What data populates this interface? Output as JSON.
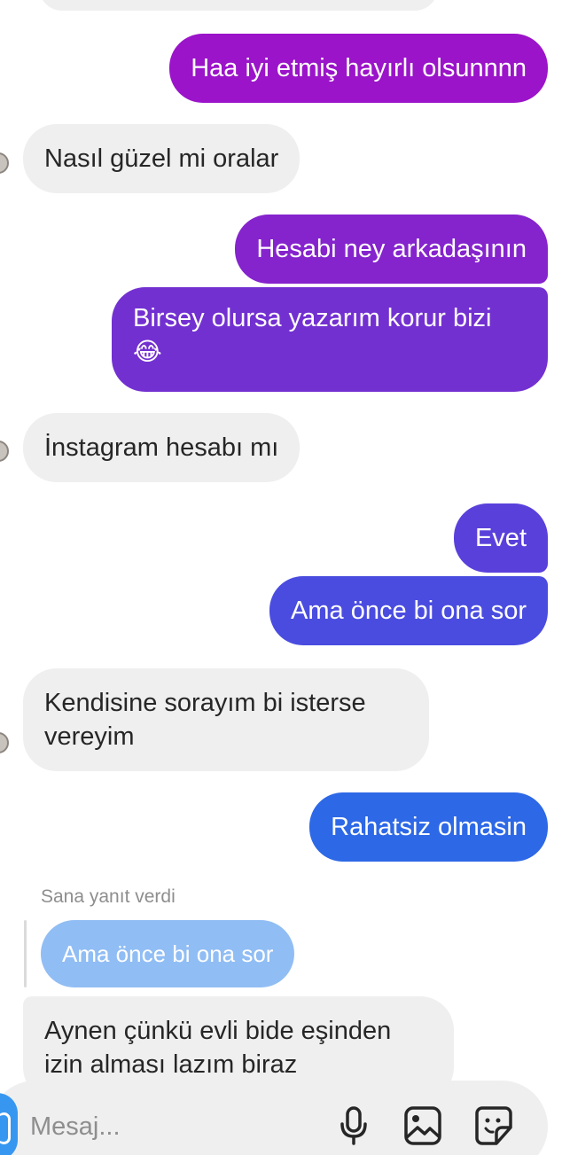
{
  "messages": [
    {
      "text": "Haa iyi etmiş hayırlı olsunnnn"
    },
    {
      "text": "Nasıl güzel mi oralar"
    },
    {
      "text": "Hesabi ney arkadaşının"
    },
    {
      "line1": "Birsey olursa yazarım korur bizi",
      "emoji": "😂"
    },
    {
      "text": "İnstagram hesabı mı"
    },
    {
      "text": "Evet"
    },
    {
      "text": "Ama önce bi ona sor"
    },
    {
      "line1": "Kendisine sorayım bi isterse",
      "line2": "vereyim"
    },
    {
      "text": "Rahatsiz olmasin"
    },
    {
      "line1": "Aynen çünkü evli bide eşinden",
      "line2": "izin alması lazım biraz"
    }
  ],
  "reply": {
    "caption": "Sana yanıt verdi",
    "quoted_text": "Ama önce bi ona sor"
  },
  "composer": {
    "placeholder": "Mesaj...",
    "icons": [
      "camera-icon",
      "microphone-icon",
      "gallery-icon",
      "sticker-icon"
    ]
  },
  "colors": {
    "outgoing_gradient": [
      "#9b14c9",
      "#7a2cd3",
      "#5f3edb",
      "#3b57e3",
      "#2a6ae6"
    ],
    "incoming_bubble": "#efefef",
    "reply_bubble": "#90bdf4",
    "accent_camera": "#3797f0"
  }
}
